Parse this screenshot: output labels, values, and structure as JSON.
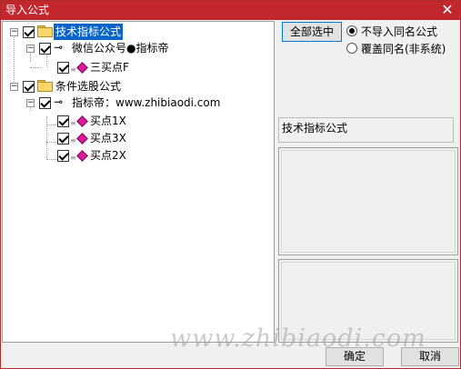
{
  "window": {
    "title": "导入公式",
    "close_glyph": "✕"
  },
  "tree": {
    "groups": [
      {
        "label": "技术指标公式",
        "selected": true,
        "children": [
          {
            "label": "微信公众号●指标帝",
            "items": [
              {
                "label": "三买点F"
              }
            ]
          }
        ]
      },
      {
        "label": "条件选股公式",
        "children": [
          {
            "label": "指标帝：www.zhibiaodi.com",
            "items": [
              {
                "label": "买点1X"
              },
              {
                "label": "买点3X"
              },
              {
                "label": "买点2X"
              }
            ]
          }
        ]
      }
    ]
  },
  "controls": {
    "select_all": "全部选中",
    "radio_no_import": "不导入同名公式",
    "radio_overwrite": "覆盖同名(非系统)",
    "selected_mode": "radio_no_import"
  },
  "info": {
    "type_label": "技术指标公式"
  },
  "footer": {
    "ok": "确定",
    "cancel": "取消"
  },
  "watermark": "www.zhibiaodi.com",
  "colors": {
    "titlebar": "#c1272d",
    "selection": "#0a64c8",
    "formula_icon": "#d81b9a"
  }
}
